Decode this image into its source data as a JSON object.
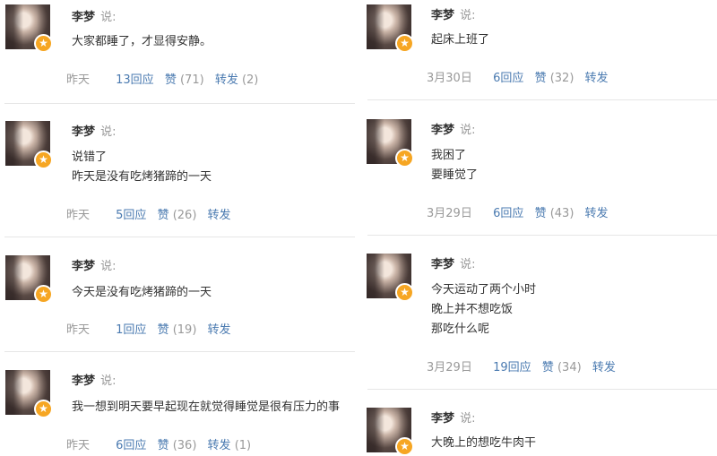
{
  "left_posts": [
    {
      "author": "李梦",
      "says": "说:",
      "lines": [
        "大家都睡了，才显得安静。"
      ],
      "time": "昨天",
      "replies": "13回应",
      "like": "赞",
      "like_count": "(71)",
      "forward": "转发",
      "forward_count": "(2)"
    },
    {
      "author": "李梦",
      "says": "说:",
      "lines": [
        "说错了",
        "昨天是没有吃烤猪蹄的一天"
      ],
      "time": "昨天",
      "replies": "5回应",
      "like": "赞",
      "like_count": "(26)",
      "forward": "转发",
      "forward_count": ""
    },
    {
      "author": "李梦",
      "says": "说:",
      "lines": [
        "今天是没有吃烤猪蹄的一天"
      ],
      "time": "昨天",
      "replies": "1回应",
      "like": "赞",
      "like_count": "(19)",
      "forward": "转发",
      "forward_count": ""
    },
    {
      "author": "李梦",
      "says": "说:",
      "lines": [
        "我一想到明天要早起现在就觉得睡觉是很有压力的事"
      ],
      "time": "昨天",
      "replies": "6回应",
      "like": "赞",
      "like_count": "(36)",
      "forward": "转发",
      "forward_count": "(1)"
    }
  ],
  "right_posts": [
    {
      "author": "李梦",
      "says": "说:",
      "lines": [
        "起床上班了"
      ],
      "time": "3月30日",
      "replies": "6回应",
      "like": "赞",
      "like_count": "(32)",
      "forward": "转发",
      "forward_count": ""
    },
    {
      "author": "李梦",
      "says": "说:",
      "lines": [
        "我困了",
        "要睡觉了"
      ],
      "time": "3月29日",
      "replies": "6回应",
      "like": "赞",
      "like_count": "(43)",
      "forward": "转发",
      "forward_count": ""
    },
    {
      "author": "李梦",
      "says": "说:",
      "lines": [
        "今天运动了两个小时",
        "晚上并不想吃饭",
        "那吃什么呢"
      ],
      "time": "3月29日",
      "replies": "19回应",
      "like": "赞",
      "like_count": "(34)",
      "forward": "转发",
      "forward_count": ""
    },
    {
      "author": "李梦",
      "says": "说:",
      "lines": [
        "大晚上的想吃牛肉干"
      ],
      "time": "",
      "replies": "",
      "like": "",
      "like_count": "",
      "forward": "",
      "forward_count": ""
    }
  ],
  "badge_icon": "star-badge-icon",
  "colors": {
    "link": "#4a7ab0",
    "muted": "#999999",
    "badge": "#f6a623",
    "divider": "#e6e6e6"
  }
}
